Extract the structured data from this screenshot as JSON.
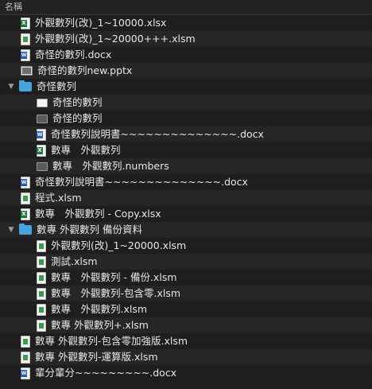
{
  "header": {
    "name_column": "名稱"
  },
  "rows": [
    {
      "label": "外觀數列(改)_1~10000.xlsx",
      "icon": "excel-icon",
      "toggle": ""
    },
    {
      "label": "外觀數列(改)_1~20000+++.xlsm",
      "icon": "spreadsheet-icon",
      "toggle": ""
    },
    {
      "label": "奇怪的數列.docx",
      "icon": "word-icon",
      "toggle": ""
    },
    {
      "label": "奇怪的數列new.pptx",
      "icon": "presentation-icon",
      "toggle": ""
    },
    {
      "label": "奇怪數列",
      "icon": "folder-icon",
      "toggle": "▼"
    },
    {
      "label": "奇怪的數列",
      "icon": "document-icon",
      "toggle": ""
    },
    {
      "label": "奇怪的數列",
      "icon": "document-icon",
      "toggle": ""
    },
    {
      "label": "奇怪數列說明書~~~~~~~~~~~~~~.docx",
      "icon": "word-icon",
      "toggle": ""
    },
    {
      "label": "數專　外觀數列",
      "icon": "excel-icon",
      "toggle": ""
    },
    {
      "label": "數專　外觀數列.numbers",
      "icon": "numbers-icon",
      "toggle": ""
    },
    {
      "label": "奇怪數列說明書~~~~~~~~~~~~~~.docx",
      "icon": "word-icon",
      "toggle": ""
    },
    {
      "label": "程式.xlsm",
      "icon": "spreadsheet-icon",
      "toggle": ""
    },
    {
      "label": "數專　外觀數列 - Copy.xlsx",
      "icon": "excel-icon",
      "toggle": ""
    },
    {
      "label": "數專 外觀數列 備份資料",
      "icon": "folder-icon",
      "toggle": "▼"
    },
    {
      "label": "外觀數列(改)_1~20000.xlsm",
      "icon": "spreadsheet-icon",
      "toggle": ""
    },
    {
      "label": "測試.xlsm",
      "icon": "spreadsheet-icon",
      "toggle": ""
    },
    {
      "label": "數專　外觀數列 - 備份.xlsm",
      "icon": "spreadsheet-icon",
      "toggle": ""
    },
    {
      "label": "數專　外觀數列-包含零.xlsm",
      "icon": "spreadsheet-icon",
      "toggle": ""
    },
    {
      "label": "數專　外觀數列.xlsm",
      "icon": "spreadsheet-icon",
      "toggle": ""
    },
    {
      "label": "數專 外觀數列+.xlsm",
      "icon": "spreadsheet-icon",
      "toggle": ""
    },
    {
      "label": "數專 外觀數列-包含零加強版.xlsm",
      "icon": "spreadsheet-icon",
      "toggle": ""
    },
    {
      "label": "數專 外觀數列-運算版.xlsm",
      "icon": "spreadsheet-icon",
      "toggle": ""
    },
    {
      "label": "輩分輩分~~~~~~~~~.docx",
      "icon": "word-icon",
      "toggle": ""
    }
  ]
}
